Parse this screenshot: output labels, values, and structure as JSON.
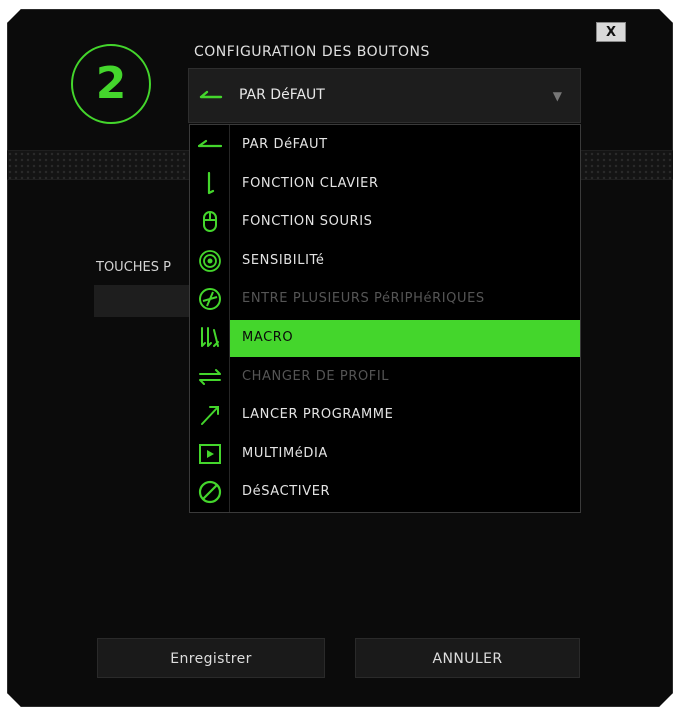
{
  "dialog": {
    "close_label": "X",
    "button_number": "2",
    "title": "CONFIGURATION DES BOUTONS"
  },
  "dropdown": {
    "selected_value": "PAR DéFAUT",
    "selected_icon": "default-arrow-icon"
  },
  "section": {
    "touches_label": "TOUCHES P"
  },
  "menu": {
    "items": [
      {
        "label": "PAR DéFAUT",
        "icon": "default-arrow-icon",
        "state": "normal"
      },
      {
        "label": "FONCTION CLAVIER",
        "icon": "keyboard-function-icon",
        "state": "normal"
      },
      {
        "label": "FONCTION SOURIS",
        "icon": "mouse-icon",
        "state": "normal"
      },
      {
        "label": "SENSIBILITé",
        "icon": "target-icon",
        "state": "normal"
      },
      {
        "label": "ENTRE PLUSIEURS PéRIPHéRIQUES",
        "icon": "inter-device-icon",
        "state": "disabled"
      },
      {
        "label": "MACRO",
        "icon": "macro-icon",
        "state": "selected"
      },
      {
        "label": "CHANGER DE PROFIL",
        "icon": "switch-profile-icon",
        "state": "disabled"
      },
      {
        "label": "LANCER PROGRAMME",
        "icon": "launch-program-icon",
        "state": "normal"
      },
      {
        "label": "MULTIMéDIA",
        "icon": "multimedia-icon",
        "state": "normal"
      },
      {
        "label": "DéSACTIVER",
        "icon": "disable-icon",
        "state": "normal"
      }
    ]
  },
  "footer": {
    "save_label": "Enregistrer",
    "cancel_label": "ANNULER"
  },
  "colors": {
    "accent": "#44d62c",
    "background": "#0b0b0b",
    "panel": "#1d1d1d",
    "disabled_text": "#555555"
  }
}
